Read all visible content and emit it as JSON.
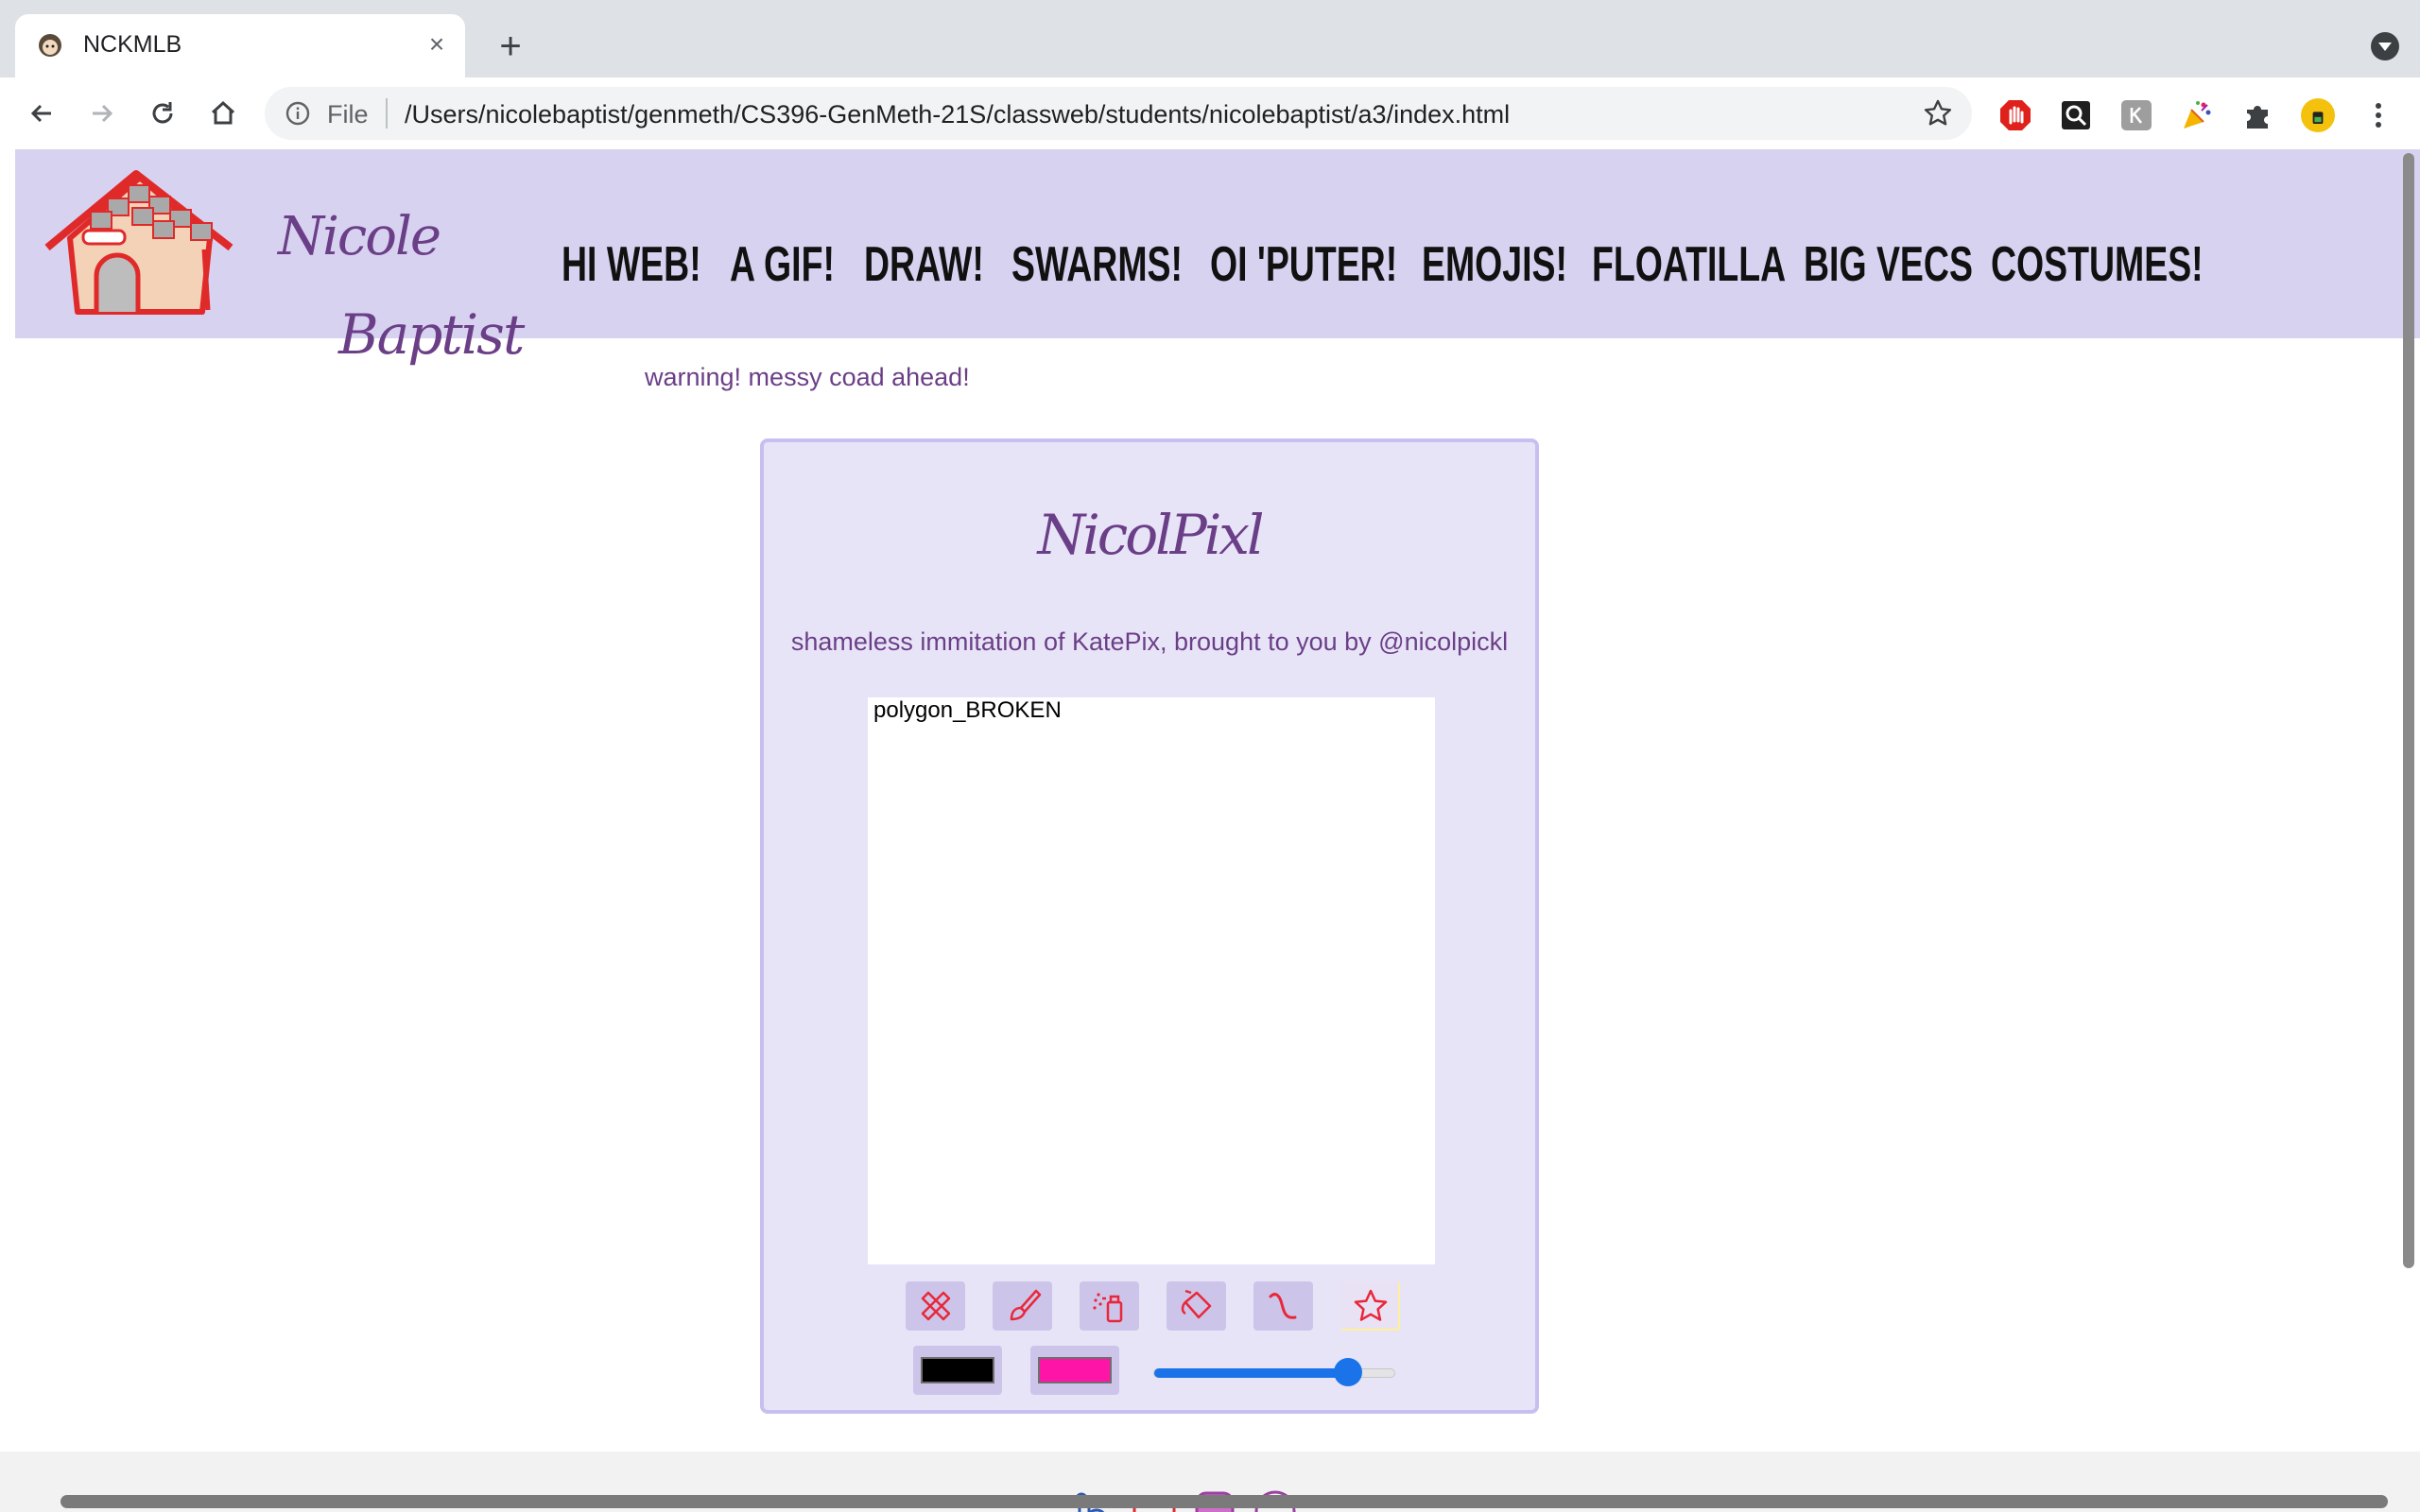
{
  "browser": {
    "tab_title": "NCKMLB",
    "tab_close": "×",
    "new_tab": "+",
    "file_label": "File",
    "url": "/Users/nicolebaptist/genmeth/CS396-GenMeth-21S/classweb/students/nicolebaptist/a3/index.html"
  },
  "site": {
    "name_first": "Nicole",
    "name_last": "Baptist",
    "nav": [
      "HI WEB!",
      "A GIF!",
      "DRAW!",
      "SWARMS!",
      "OI 'PUTER!",
      "EMOJIS!",
      "FLOATILLA",
      "BIG VECS",
      "COSTUMES!"
    ],
    "warning": "warning! messy coad ahead!"
  },
  "app": {
    "title": "NicolPixl",
    "subtitle": "shameless immitation of KatePix, brought to you by @nicolpickl",
    "canvas_mode": "polygon_BROKEN",
    "tools": [
      "eraser-icon",
      "brush-icon",
      "spray-icon",
      "bucket-icon",
      "squiggle-icon",
      "star-icon"
    ],
    "active_tool": 5,
    "color_primary": "#000000",
    "color_secondary": "#ff14a8",
    "accent": "#1a73e8",
    "brush_size_fraction": 0.8
  }
}
